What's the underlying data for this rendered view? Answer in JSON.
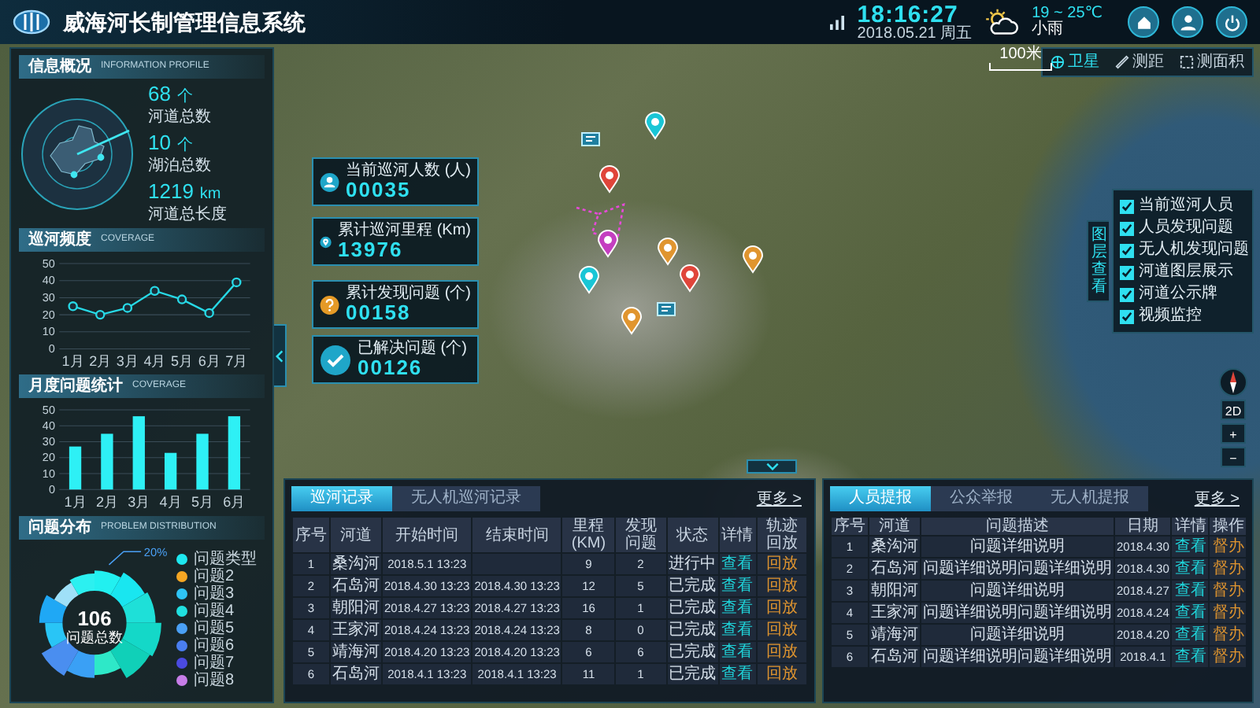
{
  "header": {
    "title": "威海河长制管理信息系统",
    "time": "18:16:27",
    "date": "2018.05.21 周五",
    "temperature": "19 ~ 25℃",
    "weather": "小雨"
  },
  "info_profile": {
    "title": "信息概况",
    "subtitle": "INFORMATION PROFILE",
    "stats": [
      {
        "value": "68",
        "unit": "个",
        "label": "河道总数"
      },
      {
        "value": "10",
        "unit": "个",
        "label": "湖泊总数"
      },
      {
        "value": "1219",
        "unit": "km",
        "label": "河道总长度"
      }
    ]
  },
  "patrol_frequency": {
    "title": "巡河频度",
    "subtitle": "COVERAGE",
    "chart_data": {
      "type": "line",
      "categories": [
        "1月",
        "2月",
        "3月",
        "4月",
        "5月",
        "6月",
        "7月"
      ],
      "series": [
        {
          "color": "#27d9e6",
          "marker": true,
          "values": [
            25,
            20,
            24,
            34,
            29,
            21,
            39
          ]
        }
      ],
      "grid": true,
      "ylim": [
        0,
        50
      ],
      "yticks": [
        0,
        10,
        20,
        30,
        40,
        50
      ]
    }
  },
  "monthly_problems": {
    "title": "月度问题统计",
    "subtitle": "COVERAGE",
    "chart_data": {
      "type": "bar",
      "categories": [
        "1月",
        "2月",
        "3月",
        "4月",
        "5月",
        "6月"
      ],
      "series": [
        {
          "color": "#2ef0f5",
          "values": [
            27,
            35,
            46,
            23,
            35,
            46
          ]
        }
      ],
      "grid": true,
      "ylim": [
        0,
        50
      ],
      "yticks": [
        0,
        10,
        20,
        30,
        40,
        50
      ]
    }
  },
  "problem_distribution": {
    "title": "问题分布",
    "subtitle": "PROBLEM DISTRIBUTION",
    "total": "106",
    "total_label": "问题总数",
    "callout": "20%",
    "legend": [
      {
        "label": "问题类型",
        "color": "#1ee8f0"
      },
      {
        "label": "问题2",
        "color": "#f5a623"
      },
      {
        "label": "问题3",
        "color": "#2ec4f5"
      },
      {
        "label": "问题4",
        "color": "#20e0e0"
      },
      {
        "label": "问题5",
        "color": "#4aa0f5"
      },
      {
        "label": "问题6",
        "color": "#4a7ef0"
      },
      {
        "label": "问题7",
        "color": "#4a4ae0"
      },
      {
        "label": "问题8",
        "color": "#c77de8"
      }
    ]
  },
  "map": {
    "scale": "100米",
    "tools": [
      {
        "label": "卫星",
        "kind": "satellite",
        "selected": true
      },
      {
        "label": "测距",
        "kind": "distance",
        "selected": false
      },
      {
        "label": "测面积",
        "kind": "area",
        "selected": false
      }
    ],
    "stats": [
      {
        "label": "当前巡河人数 (人)",
        "value": "00035",
        "kind": "person"
      },
      {
        "label": "累计巡河里程 (Km)",
        "value": "13976",
        "kind": "mileage"
      },
      {
        "label": "累计发现问题 (个)",
        "value": "00158",
        "kind": "question"
      },
      {
        "label": "已解决问题 (个)",
        "value": "00126",
        "kind": "check"
      }
    ],
    "layer_tab": "图层查看",
    "layers": [
      {
        "label": "当前巡河人员",
        "checked": true
      },
      {
        "label": "人员发现问题",
        "checked": true
      },
      {
        "label": "无人机发现问题",
        "checked": true
      },
      {
        "label": "河道图层展示",
        "checked": true
      },
      {
        "label": "河道公示牌",
        "checked": true
      },
      {
        "label": "视频监控",
        "checked": true
      }
    ],
    "zoom_controls": [
      "2D",
      "+",
      "−"
    ]
  },
  "patrol_table": {
    "tabs": [
      {
        "label": "巡河记录",
        "selected": true
      },
      {
        "label": "无人机巡河记录",
        "selected": false
      }
    ],
    "more": "更多 >",
    "columns": [
      {
        "label": "序号",
        "kind": "figure"
      },
      {
        "label": "河道",
        "kind": "text"
      },
      {
        "label": "开始时间",
        "kind": "figure"
      },
      {
        "label": "结束时间",
        "kind": "figure"
      },
      {
        "label": "里程(KM)",
        "kind": "figure"
      },
      {
        "label": "发现问题",
        "kind": "figure"
      },
      {
        "label": "状态",
        "kind": "text"
      },
      {
        "label": "详情",
        "kind": "link"
      },
      {
        "label": "轨迹回放",
        "kind": "action"
      }
    ],
    "rows": [
      [
        "1",
        "桑沟河",
        "2018.5.1 13:23",
        null,
        "9",
        "2",
        "进行中",
        "查看",
        "回放"
      ],
      [
        "2",
        "石岛河",
        "2018.4.30 13:23",
        "2018.4.30 13:23",
        "12",
        "5",
        "已完成",
        "查看",
        "回放"
      ],
      [
        "3",
        "朝阳河",
        "2018.4.27 13:23",
        "2018.4.27 13:23",
        "16",
        "1",
        "已完成",
        "查看",
        "回放"
      ],
      [
        "4",
        "王家河",
        "2018.4.24 13:23",
        "2018.4.24 13:23",
        "8",
        "0",
        "已完成",
        "查看",
        "回放"
      ],
      [
        "5",
        "靖海河",
        "2018.4.20 13:23",
        "2018.4.20 13:23",
        "6",
        "6",
        "已完成",
        "查看",
        "回放"
      ],
      [
        "6",
        "石岛河",
        "2018.4.1 13:23",
        "2018.4.1 13:23",
        "11",
        "1",
        "已完成",
        "查看",
        "回放"
      ]
    ]
  },
  "report_table": {
    "tabs": [
      {
        "label": "人员提报",
        "selected": true
      },
      {
        "label": "公众举报",
        "selected": false
      },
      {
        "label": "无人机提报",
        "selected": false
      }
    ],
    "more": "更多 >",
    "columns": [
      {
        "label": "序号",
        "kind": "figure"
      },
      {
        "label": "河道",
        "kind": "text"
      },
      {
        "label": "问题描述",
        "kind": "text"
      },
      {
        "label": "日期",
        "kind": "figure"
      },
      {
        "label": "详情",
        "kind": "link"
      },
      {
        "label": "操作",
        "kind": "action"
      }
    ],
    "rows": [
      [
        "1",
        "桑沟河",
        "问题详细说明",
        "2018.4.30",
        "查看",
        "督办"
      ],
      [
        "2",
        "石岛河",
        "问题详细说明问题详细说明",
        "2018.4.30",
        "查看",
        "督办"
      ],
      [
        "3",
        "朝阳河",
        "问题详细说明",
        "2018.4.27",
        "查看",
        "督办"
      ],
      [
        "4",
        "王家河",
        "问题详细说明问题详细说明",
        "2018.4.24",
        "查看",
        "督办"
      ],
      [
        "5",
        "靖海河",
        "问题详细说明",
        "2018.4.20",
        "查看",
        "督办"
      ],
      [
        "6",
        "石岛河",
        "问题详细说明问题详细说明",
        "2018.4.1",
        "查看",
        "督办"
      ]
    ]
  }
}
